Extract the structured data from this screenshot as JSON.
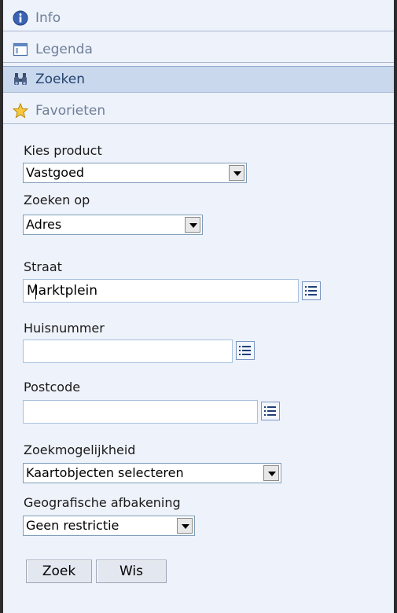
{
  "tabs": [
    {
      "label": "Info",
      "icon": "info-icon",
      "active": false
    },
    {
      "label": "Legenda",
      "icon": "legend-icon",
      "active": false
    },
    {
      "label": "Zoeken",
      "icon": "binoculars-icon",
      "active": true
    },
    {
      "label": "Favorieten",
      "icon": "star-icon",
      "active": false
    }
  ],
  "form": {
    "product_label": "Kies product",
    "product_value": "Vastgoed",
    "search_on_label": "Zoeken op",
    "search_on_value": "Adres",
    "street_label": "Straat",
    "street_value": "Marktplein",
    "housenumber_label": "Huisnummer",
    "housenumber_value": "",
    "postcode_label": "Postcode",
    "postcode_value": "",
    "search_option_label": "Zoekmogelijkheid",
    "search_option_value": "Kaartobjecten selecteren",
    "geo_label": "Geografische afbakening",
    "geo_value": "Geen restrictie"
  },
  "buttons": {
    "search": "Zoek",
    "clear": "Wis"
  },
  "colors": {
    "panel_bg": "#eef2fa",
    "active_tab_bg": "#c9d8ec",
    "active_tab_text": "#24436f",
    "inactive_tab_text": "#6f7f9a"
  }
}
